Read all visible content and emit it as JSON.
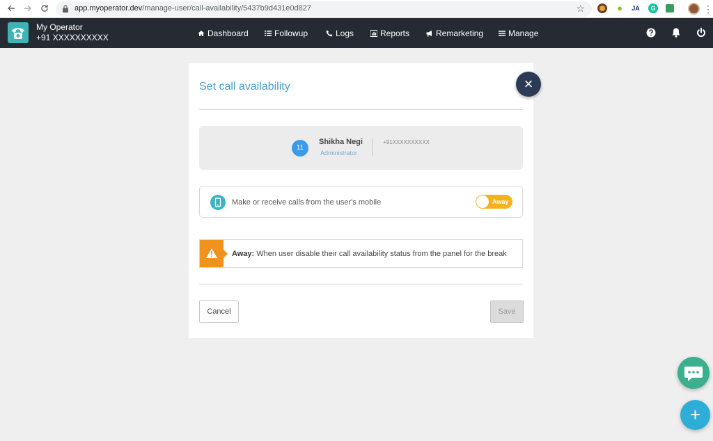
{
  "browser": {
    "url_host": "app.myoperator.dev",
    "url_path": "/manage-user/call-availability/5437b9d431e0d827",
    "back_icon": "arrow-left-icon",
    "forward_icon": "arrow-right-icon",
    "reload_icon": "reload-icon",
    "bookmark_icon": "star-icon",
    "extensions": [
      "chrome-ext-icon",
      "bulb-icon",
      "ja-ext-icon",
      "grammarly-icon",
      "pen-ext-icon"
    ],
    "ext_ja_label": "JA",
    "ext_g_label": "G",
    "menu_label": "⋮"
  },
  "header": {
    "brand_name": "My Operator",
    "brand_phone": "+91 XXXXXXXXXX",
    "nav": [
      {
        "label": "Dashboard",
        "icon": "home-icon"
      },
      {
        "label": "Followup",
        "icon": "list-icon"
      },
      {
        "label": "Logs",
        "icon": "phone-icon"
      },
      {
        "label": "Reports",
        "icon": "bar-chart-icon"
      },
      {
        "label": "Remarketing",
        "icon": "megaphone-icon"
      },
      {
        "label": "Manage",
        "icon": "menu-icon"
      }
    ],
    "right_icons": [
      "help-icon",
      "bell-icon",
      "power-icon"
    ]
  },
  "modal": {
    "title": "Set call availability",
    "close_label": "×",
    "user": {
      "avatar_text": "11",
      "name": "Shikha Negi",
      "role": "Administrator",
      "phone": "+91XXXXXXXXXX"
    },
    "mobile_option": {
      "label": "Make or receive calls from the user's mobile",
      "toggle_label": "Away"
    },
    "away_note": {
      "bold": "Away:",
      "text": " When user disable their call availability status from the panel for the break"
    },
    "cancel_label": "Cancel",
    "save_label": "Save"
  },
  "fabs": {
    "plus_label": "+"
  },
  "colors": {
    "header_bg": "#252a33",
    "accent_blue": "#4a9ccd",
    "toggle_yellow": "#f7b11e",
    "warning_orange": "#f0931c",
    "chat_green": "#3bb08f",
    "fab_blue": "#2eaed6"
  }
}
